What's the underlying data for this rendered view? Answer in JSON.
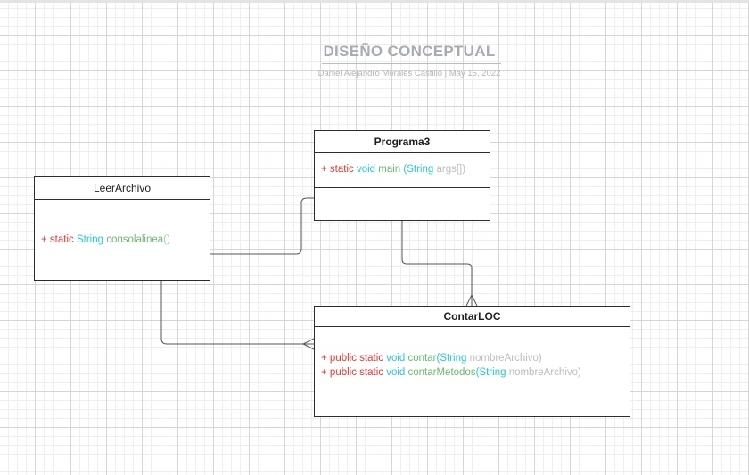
{
  "diagram": {
    "title": "DISEÑO CONCEPTUAL",
    "subtitle": "Daniel Alejandro Morales Castillo  |  May 15, 2022",
    "colors": {
      "keyword": "#e53935",
      "type": "#26c6da",
      "method": "#66bb6a",
      "param": "#bdbdbd",
      "border": "#2c2c2c",
      "title": "#a7abb4"
    },
    "classes": {
      "programa3": {
        "name": "Programa3",
        "ops": [
          {
            "plus": "+ ",
            "k1": "static ",
            "k2": "void ",
            "name": "main ",
            "open": "(",
            "type": "String ",
            "param": "args[])"
          }
        ]
      },
      "leerarchivo": {
        "name": "LeerArchivo",
        "ops": [
          {
            "plus": "+ ",
            "k1": "static ",
            "type": "String ",
            "name": "consolalinea",
            "rest": "()"
          }
        ]
      },
      "contarloc": {
        "name": "ContarLOC",
        "ops": [
          {
            "plus": "+ ",
            "k1": "public ",
            "k2": "static ",
            "k3": "void ",
            "name": "contar",
            "open": "(",
            "type": "String ",
            "param": "nombreArchivo)"
          },
          {
            "plus": "+ ",
            "k1": "public ",
            "k2": "static ",
            "k3": "void ",
            "name": "contarMetodos",
            "open": "(",
            "type": "String ",
            "param": "nombreArchivo)"
          }
        ]
      }
    }
  }
}
